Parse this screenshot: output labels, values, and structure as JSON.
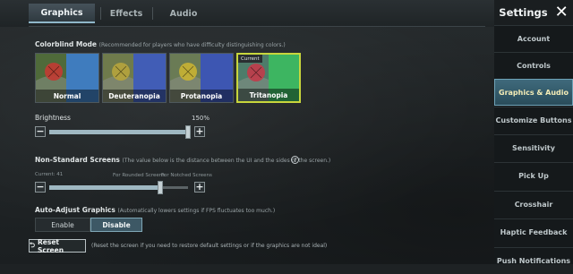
{
  "tabs": [
    {
      "label": "Graphics",
      "active": true
    },
    {
      "label": "Effects",
      "active": false
    },
    {
      "label": "Audio",
      "active": false
    }
  ],
  "header": {
    "title": "Settings",
    "close_icon": "close-icon"
  },
  "sidebar": {
    "items": [
      {
        "label": "Account",
        "active": false
      },
      {
        "label": "Controls",
        "active": false
      },
      {
        "label": "Graphics & Audio",
        "active": true
      },
      {
        "label": "Customize Buttons",
        "active": false
      },
      {
        "label": "Sensitivity",
        "active": false
      },
      {
        "label": "Pick Up",
        "active": false
      },
      {
        "label": "Crosshair",
        "active": false
      },
      {
        "label": "Haptic Feedback",
        "active": false
      },
      {
        "label": "Push Notifications",
        "active": false
      }
    ]
  },
  "colorblind": {
    "title": "Colorblind Mode",
    "note": "(Recommended for players who have difficulty distinguishing colors.)",
    "current_badge": "Current",
    "options": [
      {
        "label": "Normal",
        "colors": [
          "#c23b33",
          "#3c7fd6",
          "#4f6a3a"
        ],
        "selected": false
      },
      {
        "label": "Deuteranopia",
        "colors": [
          "#b6a43d",
          "#3a58c9",
          "#6f7b4c"
        ],
        "selected": false
      },
      {
        "label": "Protanopia",
        "colors": [
          "#c9b233",
          "#3550c3",
          "#6a7b55"
        ],
        "selected": false
      },
      {
        "label": "Tritanopia",
        "colors": [
          "#c23b4a",
          "#3bbf5f",
          "#4d7c6a"
        ],
        "selected": true
      }
    ]
  },
  "brightness": {
    "label": "Brightness",
    "value_text": "150%",
    "level": 1.0
  },
  "non_standard": {
    "title": "Non-Standard Screens",
    "note": "(The value below is the distance between the UI and the sides of the screen.)",
    "current_text": "Current: 41",
    "rounded_label": "For Rounded Screens",
    "notched_label": "For Notched Screens",
    "level": 0.8
  },
  "auto_adjust": {
    "title": "Auto-Adjust Graphics",
    "note": "(Automatically lowers settings if FPS fluctuates too much.)",
    "enable_label": "Enable",
    "disable_label": "Disable",
    "selected": "Disable"
  },
  "reset": {
    "button_label": "Reset Screen",
    "note": "(Reset the screen if you need to restore default settings or if the graphics are not ideal)"
  },
  "colors": {
    "accent": "#3f6a7c",
    "highlight": "#c8d63c",
    "active_text": "#f4ecb6"
  }
}
